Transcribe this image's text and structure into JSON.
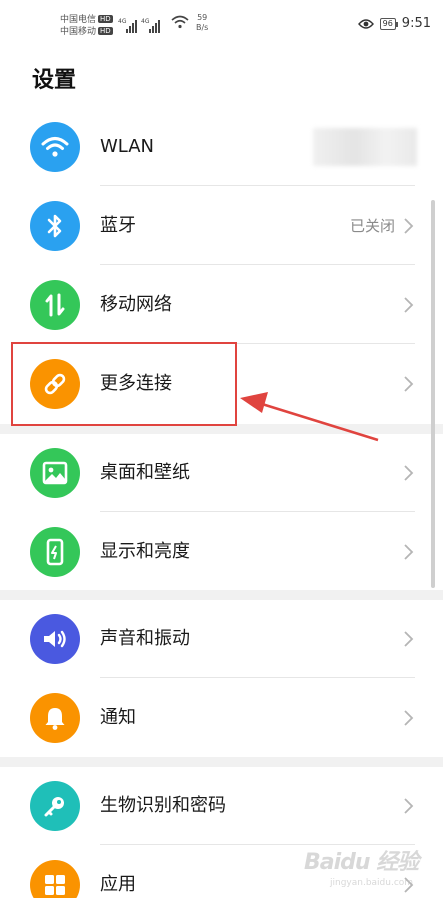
{
  "status_bar": {
    "carrier1": "中国电信",
    "carrier2": "中国移动",
    "hd_badge": "HD",
    "network_tag": "4G",
    "speed_value": "59",
    "speed_unit": "B/s",
    "battery": "96",
    "time": "9:51",
    "eye_icon": "eye-comfort-icon",
    "wifi_icon": "wifi-status-icon"
  },
  "page_title": "设置",
  "groups": [
    {
      "items": [
        {
          "label": "WLAN",
          "value": "",
          "icon": "wifi-icon",
          "color": "#2aa1f0"
        },
        {
          "label": "蓝牙",
          "value": "已关闭",
          "icon": "bluetooth-icon",
          "color": "#2aa1f0"
        },
        {
          "label": "移动网络",
          "value": "",
          "icon": "mobile-network-icon",
          "color": "#34c759"
        },
        {
          "label": "更多连接",
          "value": "",
          "icon": "link-icon",
          "color": "#fa9300"
        }
      ]
    },
    {
      "items": [
        {
          "label": "桌面和壁纸",
          "value": "",
          "icon": "wallpaper-icon",
          "color": "#34c759"
        },
        {
          "label": "显示和亮度",
          "value": "",
          "icon": "display-icon",
          "color": "#34c759"
        }
      ]
    },
    {
      "items": [
        {
          "label": "声音和振动",
          "value": "",
          "icon": "sound-icon",
          "color": "#4a59e0"
        },
        {
          "label": "通知",
          "value": "",
          "icon": "notification-bell-icon",
          "color": "#fa9300"
        }
      ]
    },
    {
      "items": [
        {
          "label": "生物识别和密码",
          "value": "",
          "icon": "key-icon",
          "color": "#1fbfb8"
        },
        {
          "label": "应用",
          "value": "",
          "icon": "apps-grid-icon",
          "color": "#fa9300"
        }
      ]
    }
  ],
  "annotation": {
    "highlight_color": "#e0443f"
  },
  "watermark": {
    "main": "Baidu 经验",
    "sub": "jingyan.baidu.com"
  }
}
